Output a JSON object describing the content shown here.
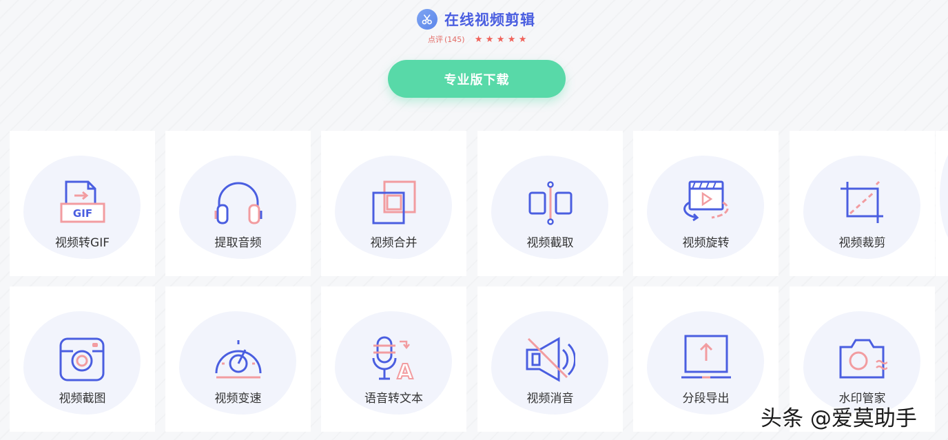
{
  "brand": {
    "title": "在线视频剪辑",
    "icon": "scissors-icon",
    "accent": "#4a5ee0"
  },
  "rating": {
    "label": "点评",
    "count": "(145)",
    "stars": 5,
    "max_stars": 5,
    "star_glyph": "★"
  },
  "download_button": {
    "label": "专业版下载",
    "color": "#58d9a8"
  },
  "tools": [
    {
      "label": "视频转GIF",
      "icon": "gif-convert-icon"
    },
    {
      "label": "提取音频",
      "icon": "headphones-icon"
    },
    {
      "label": "视频合并",
      "icon": "merge-icon"
    },
    {
      "label": "视频截取",
      "icon": "clip-icon"
    },
    {
      "label": "视频旋转",
      "icon": "rotate-video-icon"
    },
    {
      "label": "视频裁剪",
      "icon": "crop-icon"
    },
    {
      "label": "视频截图",
      "icon": "camera-icon"
    },
    {
      "label": "视频变速",
      "icon": "speedometer-icon"
    },
    {
      "label": "语音转文本",
      "icon": "microphone-text-icon"
    },
    {
      "label": "视频消音",
      "icon": "mute-icon"
    },
    {
      "label": "分段导出",
      "icon": "export-icon"
    },
    {
      "label": "水印管家",
      "icon": "watermark-camera-icon"
    }
  ],
  "watermark": {
    "text": "头条 @爱莫助手"
  },
  "colors": {
    "icon_primary": "#4a5ee0",
    "icon_secondary": "#f29ca0"
  }
}
